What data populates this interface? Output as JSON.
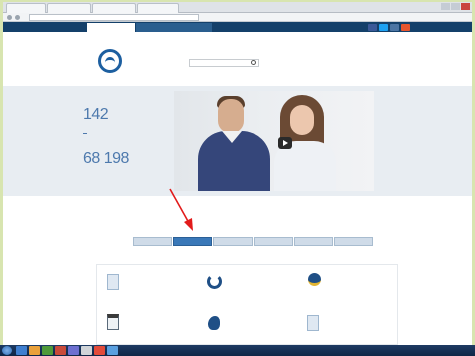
{
  "browser": {
    "tabs": [
      "",
      "",
      "",
      ""
    ],
    "url": ""
  },
  "site": {
    "top_tabs": [
      "",
      ""
    ],
    "social_colors": [
      "#3b5998",
      "#1da1f2",
      "#4c75a3",
      "#e7562e"
    ],
    "logo_text": "",
    "tagline": "",
    "search_placeholder": "",
    "phone_caption": "",
    "phone": "",
    "header_right": [
      "",
      "",
      ""
    ]
  },
  "hero": {
    "stats": [
      {
        "value": "142",
        "caption": ""
      },
      {
        "value": "68 198",
        "caption": ""
      }
    ],
    "slide_number": ""
  },
  "services": {
    "title": "",
    "tabs": [
      {
        "label": "",
        "active": false
      },
      {
        "label": "",
        "active": true
      },
      {
        "label": "",
        "active": false
      },
      {
        "label": "",
        "active": false
      },
      {
        "label": "",
        "active": false
      },
      {
        "label": "",
        "active": false
      }
    ],
    "items": [
      {
        "icon": "document-icon",
        "text": ""
      },
      {
        "icon": "horseshoe-icon",
        "text": ""
      },
      {
        "icon": "medal-icon",
        "text": ""
      },
      {
        "icon": "id-badge-icon",
        "text": ""
      },
      {
        "icon": "rabbit-icon",
        "text": ""
      },
      {
        "icon": "document-icon",
        "text": ""
      }
    ]
  },
  "taskbar": {
    "clock": ""
  },
  "colors": {
    "brand_blue": "#1d5fa0",
    "top_strip": "#14406a",
    "active_tab": "#3a78b8",
    "annotation_arrow": "#e21b1b"
  }
}
